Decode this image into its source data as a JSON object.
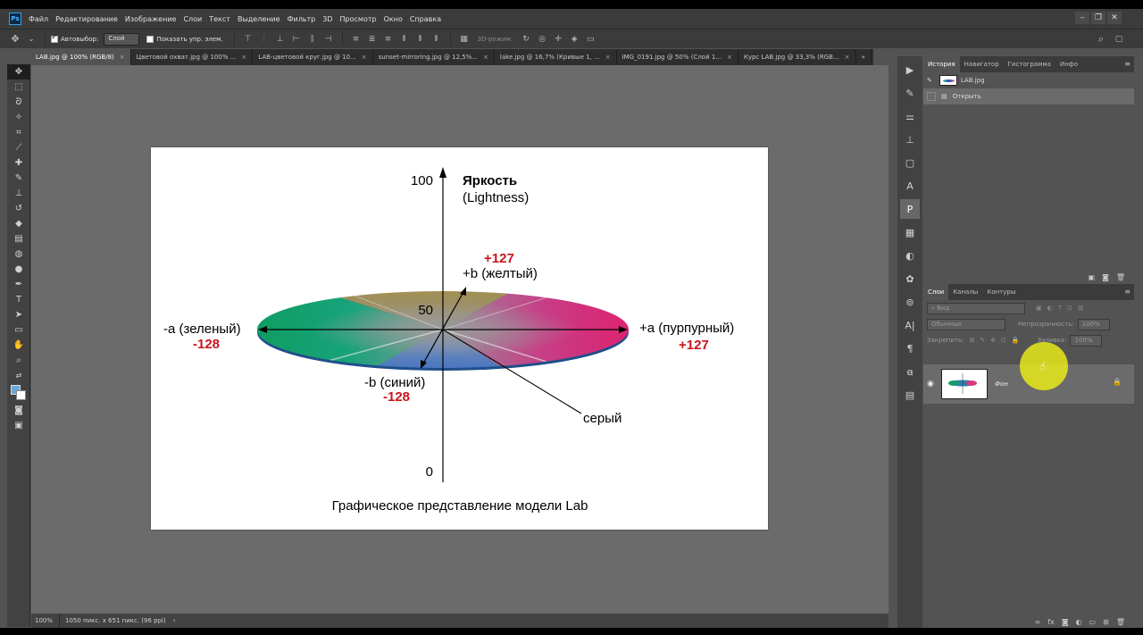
{
  "menu": [
    "Файл",
    "Редактирование",
    "Изображение",
    "Слои",
    "Текст",
    "Выделение",
    "Фильтр",
    "3D",
    "Просмотр",
    "Окно",
    "Справка"
  ],
  "app_logo": "Ps",
  "options": {
    "autoselect_label": "Автовыбор:",
    "autoselect_value": "Слой",
    "show_controls_label": "Показать упр. элем.",
    "mode_3d_label": "3D-режим:"
  },
  "tabs": [
    {
      "label": "LAB.jpg @ 100% (RGB/8)",
      "active": true
    },
    {
      "label": "Цветовой охват.jpg @ 100% ...",
      "active": false
    },
    {
      "label": "LAB-цветовой круг.jpg @ 10...",
      "active": false
    },
    {
      "label": "sunset-mirroring.jpg @ 12,5%...",
      "active": false
    },
    {
      "label": "lake.jpg @ 16,7% (Кривые 1, ...",
      "active": false
    },
    {
      "label": "IMG_0191.jpg @ 50% (Слой 1...",
      "active": false
    },
    {
      "label": "Курс LAB.jpg @ 33,3% (RGB...",
      "active": false
    }
  ],
  "tab_overflow": "»",
  "diagram": {
    "label_100": "100",
    "label_50": "50",
    "label_0": "0",
    "lightness_title": "Яркость",
    "lightness_sub": "(Lightness)",
    "plus_b_value": "+127",
    "plus_b_label": "+b (желтый)",
    "minus_a_label": "-a (зеленый)",
    "minus_a_value": "-128",
    "plus_a_label": "+a (пурпурный)",
    "plus_a_value": "+127",
    "minus_b_label": "-b (синий)",
    "minus_b_value": "-128",
    "gray_label": "серый",
    "caption": "Графическое представление модели Lab",
    "value_color": "#c8141c",
    "disc_colors": {
      "green": "#159a6c",
      "blue": "#2257c8",
      "magenta": "#de2f72",
      "yellow": "#a08a2e",
      "gray": "#8f8f8f"
    }
  },
  "status": {
    "zoom": "100%",
    "info": "1050 пикс. x 651 пикс. (96 ppi)",
    "arrow": "›"
  },
  "history_panel": {
    "tabs": [
      "История",
      "Навигатор",
      "Гистограмма",
      "Инфо"
    ],
    "snapshot_name": "LAB.jpg",
    "step_name": "Открыть"
  },
  "layers_panel": {
    "tabs": [
      "Слои",
      "Каналы",
      "Контуры"
    ],
    "filter_placeholder": "Вид",
    "blend_mode": "Обычные",
    "opacity_label": "Непрозрачность:",
    "opacity_value": "100%",
    "lock_label": "Закрепить:",
    "fill_label": "Заливка:",
    "fill_value": "100%",
    "layer_name": "Фон"
  }
}
